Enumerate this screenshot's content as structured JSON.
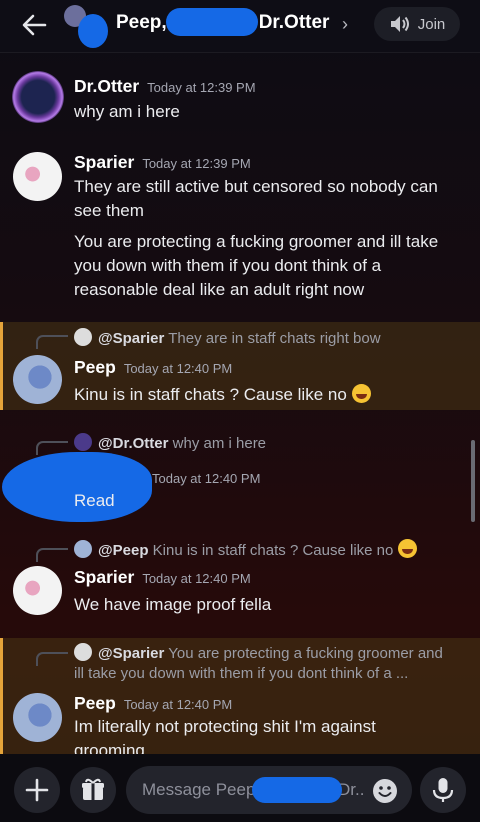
{
  "header": {
    "title_start": "Peep,",
    "title_end": "Dr.Otter",
    "chevron": "›",
    "join_label": "Join",
    "back_icon": "arrow-left-icon",
    "join_icon": "speaker-icon"
  },
  "messages": [
    {
      "author": "Dr.Otter",
      "time": "Today at 12:39 PM",
      "lines": [
        "why am i here"
      ]
    },
    {
      "author": "Sparier",
      "time": "Today at 12:39 PM",
      "lines": [
        "They are still active but censored so nobody can see them",
        "You are protecting a fucking groomer and ill take you down with them if you dont think of a reasonable deal like an adult right now"
      ]
    },
    {
      "reply_to": "@Sparier",
      "reply_text": "They are in staff chats right bow",
      "author": "Peep",
      "time": "Today at 12:40 PM",
      "text": "Kinu is in staff chats ? Cause like no",
      "highlighted": true
    },
    {
      "reply_to": "@Dr.Otter",
      "reply_text": "why am i here",
      "author": "",
      "time": "Today at 12:40 PM",
      "text": "Read"
    },
    {
      "reply_to": "@Peep",
      "reply_text": "Kinu is in staff chats ? Cause like no",
      "author": "Sparier",
      "time": "Today at 12:40 PM",
      "text": "We have image proof fella"
    },
    {
      "reply_to": "@Sparier",
      "reply_text_1": "You are protecting a fucking groomer and",
      "reply_text_2": "ill take you down with them if you dont think of a ...",
      "author": "Peep",
      "time": "Today at 12:40 PM",
      "text": "Im literally not protecting shit I'm against grooming",
      "highlighted": true
    }
  ],
  "composer": {
    "placeholder_start": "Message Peep",
    "placeholder_end": "Dr..",
    "icons": [
      "plus-icon",
      "gift-icon",
      "emoji-icon",
      "microphone-icon"
    ]
  },
  "colors": {
    "highlight_bar": "#e5a43a",
    "blue_blot": "#1569e6"
  }
}
